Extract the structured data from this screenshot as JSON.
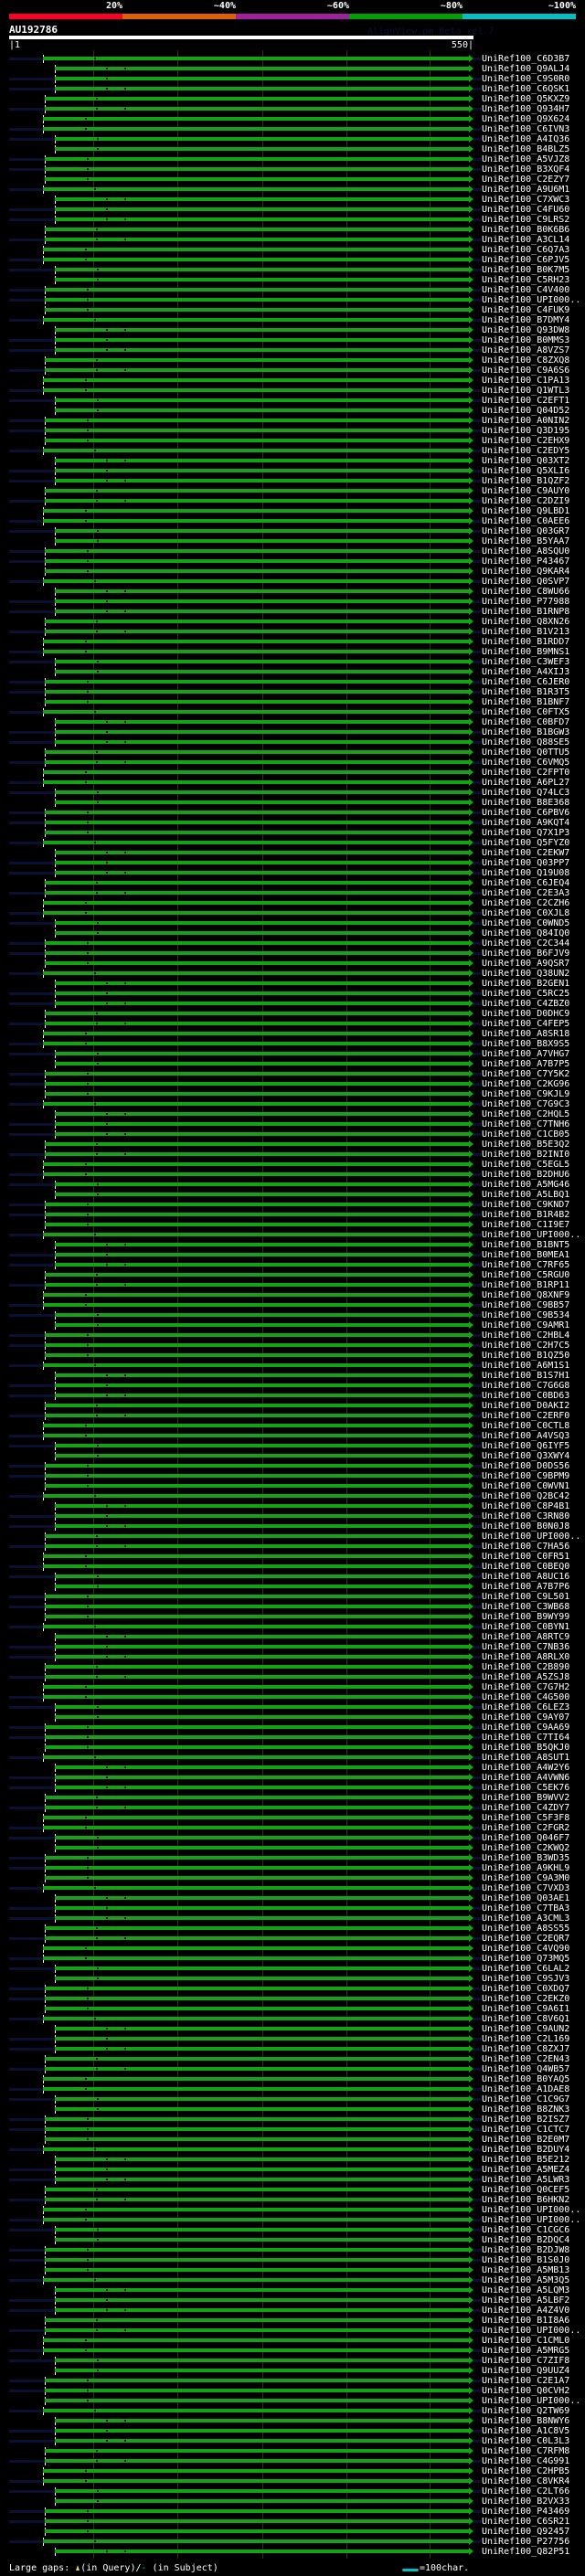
{
  "legend": {
    "scale": [
      {
        "label": "20%",
        "color": "#ff0022"
      },
      {
        "label": "~40%",
        "color": "#e06000"
      },
      {
        "label": "~60%",
        "color": "#a020a0"
      },
      {
        "label": "~80%",
        "color": "#00a000"
      },
      {
        "label": "~100%",
        "color": "#00c0c8"
      }
    ]
  },
  "header": {
    "query_id": "AU192786",
    "credit": "AlignView.pm Beta rel.7",
    "ruler_start": "|1",
    "ruler_end": "550|"
  },
  "colors": {
    "hit_bar": "#13a313",
    "unaligned": "#0b1033",
    "background": "#000000"
  },
  "rows": [
    "UniRef100_C6D3B7",
    "UniRef100_Q9ALJ4",
    "UniRef100_C9S0R0",
    "UniRef100_C6QSK1",
    "UniRef100_Q5KXZ9",
    "UniRef100_Q934H7",
    "UniRef100_Q9X624",
    "UniRef100_C6IVN3",
    "UniRef100_A4IQ36",
    "UniRef100_B4BLZ5",
    "UniRef100_A5VJZ8",
    "UniRef100_B3XQF4",
    "UniRef100_C2EZY7",
    "UniRef100_A9U6M1",
    "UniRef100_C7XWC3",
    "UniRef100_C4FU60",
    "UniRef100_C9LRS2",
    "UniRef100_B0K6B6",
    "UniRef100_A3CL14",
    "UniRef100_C6Q7A3",
    "UniRef100_C6PJV5",
    "UniRef100_B0K7M5",
    "UniRef100_C5RH23",
    "UniRef100_C4V400",
    "UniRef100_UPI000..",
    "UniRef100_C4FUK9",
    "UniRef100_B7DMY4",
    "UniRef100_Q93DW8",
    "UniRef100_B0MMS3",
    "UniRef100_A8VZS7",
    "UniRef100_C8ZXQ8",
    "UniRef100_C9A6S6",
    "UniRef100_C1PA13",
    "UniRef100_Q1WTL3",
    "UniRef100_C2EFT1",
    "UniRef100_Q04D52",
    "UniRef100_A0NIN2",
    "UniRef100_Q3D195",
    "UniRef100_C2EHX9",
    "UniRef100_C2EDY5",
    "UniRef100_Q03XT2",
    "UniRef100_Q5XLI6",
    "UniRef100_B1QZF2",
    "UniRef100_C9AUY0",
    "UniRef100_C2DZI9",
    "UniRef100_Q9LBD1",
    "UniRef100_C0AEE6",
    "UniRef100_Q03GR7",
    "UniRef100_B5YAA7",
    "UniRef100_A8SQU0",
    "UniRef100_P43467",
    "UniRef100_Q9KAR4",
    "UniRef100_Q0SVP7",
    "UniRef100_C8WU66",
    "UniRef100_P77988",
    "UniRef100_B1RNP8",
    "UniRef100_Q8XN26",
    "UniRef100_B1V213",
    "UniRef100_B1RDD7",
    "UniRef100_B9MNS1",
    "UniRef100_C3WEF3",
    "UniRef100_A4XIJ3",
    "UniRef100_C6JER0",
    "UniRef100_B1R3T5",
    "UniRef100_B1BNF7",
    "UniRef100_C0FTX5",
    "UniRef100_C0BFD7",
    "UniRef100_B1BGW3",
    "UniRef100_Q88SE5",
    "UniRef100_Q0TTU5",
    "UniRef100_C6VMQ5",
    "UniRef100_C2FPT0",
    "UniRef100_A6PL27",
    "UniRef100_Q74LC3",
    "UniRef100_B8E368",
    "UniRef100_C6PBV6",
    "UniRef100_A9KQT4",
    "UniRef100_Q7X1P3",
    "UniRef100_Q5FYZ0",
    "UniRef100_C2EKW7",
    "UniRef100_Q03PP7",
    "UniRef100_Q19U08",
    "UniRef100_C6JEQ4",
    "UniRef100_C2E3A3",
    "UniRef100_C2CZH6",
    "UniRef100_C0XJL8",
    "UniRef100_C0WND5",
    "UniRef100_Q84IQ0",
    "UniRef100_C2C344",
    "UniRef100_B6FJV9",
    "UniRef100_A9QSR7",
    "UniRef100_Q38UN2",
    "UniRef100_B2GEN1",
    "UniRef100_C5RC25",
    "UniRef100_C4ZBZ0",
    "UniRef100_D0DHC9",
    "UniRef100_C4FEP5",
    "UniRef100_A8SR18",
    "UniRef100_B8X9S5",
    "UniRef100_A7VHG7",
    "UniRef100_A7B7P5",
    "UniRef100_C7Y5K2",
    "UniRef100_C2KG96",
    "UniRef100_C9KJL9",
    "UniRef100_C7G9C3",
    "UniRef100_C2HQL5",
    "UniRef100_C7TNH6",
    "UniRef100_C1CB05",
    "UniRef100_B5E3Q2",
    "UniRef100_B2INI0",
    "UniRef100_C5EGL5",
    "UniRef100_B2DHU6",
    "UniRef100_A5MG46",
    "UniRef100_A5LBQ1",
    "UniRef100_C9KND7",
    "UniRef100_B1R4B2",
    "UniRef100_C1I9E7",
    "UniRef100_UPI000..",
    "UniRef100_B1BNT5",
    "UniRef100_B0MEA1",
    "UniRef100_C7RF65",
    "UniRef100_C5RGU0",
    "UniRef100_B1RP11",
    "UniRef100_Q8XNF9",
    "UniRef100_C9BB57",
    "UniRef100_C9B534",
    "UniRef100_C9AMR1",
    "UniRef100_C2HBL4",
    "UniRef100_C2H7C5",
    "UniRef100_B1QZ50",
    "UniRef100_A6M1S1",
    "UniRef100_B1S7H1",
    "UniRef100_C7G6G8",
    "UniRef100_C0BD63",
    "UniRef100_D0AKI2",
    "UniRef100_C2ERF0",
    "UniRef100_C0CTL8",
    "UniRef100_A4VSQ3",
    "UniRef100_Q6IYF5",
    "UniRef100_Q3XWY4",
    "UniRef100_D0DS56",
    "UniRef100_C9BPM9",
    "UniRef100_C0WVN1",
    "UniRef100_Q2BC42",
    "UniRef100_C8P4B1",
    "UniRef100_C3RN80",
    "UniRef100_B0N0J8",
    "UniRef100_UPI000..",
    "UniRef100_C7HA56",
    "UniRef100_C0FR51",
    "UniRef100_C0BEQ0",
    "UniRef100_A8UC16",
    "UniRef100_A7B7P6",
    "UniRef100_C9L501",
    "UniRef100_C3WB68",
    "UniRef100_B9WY99",
    "UniRef100_C0BYN1",
    "UniRef100_A8RTC9",
    "UniRef100_C7NB36",
    "UniRef100_A8RLX0",
    "UniRef100_C2B890",
    "UniRef100_A5ZSJ8",
    "UniRef100_C7G7H2",
    "UniRef100_C4G500",
    "UniRef100_C6LEZ3",
    "UniRef100_C9AY07",
    "UniRef100_C9AA69",
    "UniRef100_C7TI64",
    "UniRef100_B5QKJ0",
    "UniRef100_A8SUT1",
    "UniRef100_A4W2Y6",
    "UniRef100_A4VWN6",
    "UniRef100_C5EK76",
    "UniRef100_B9WVV2",
    "UniRef100_C4ZDY7",
    "UniRef100_C5F3F8",
    "UniRef100_C2FGR2",
    "UniRef100_Q046F7",
    "UniRef100_C2KWQ2",
    "UniRef100_B3WD35",
    "UniRef100_A9KHL9",
    "UniRef100_C9A3M0",
    "UniRef100_C7VXD3",
    "UniRef100_Q03AE1",
    "UniRef100_C7TBA3",
    "UniRef100_A3CML3",
    "UniRef100_A8SS55",
    "UniRef100_C2EQR7",
    "UniRef100_C4VQ90",
    "UniRef100_Q73MQ5",
    "UniRef100_C6LAL2",
    "UniRef100_C9SJV3",
    "UniRef100_C0XDQ7",
    "UniRef100_C2EKZ0",
    "UniRef100_C9A6I1",
    "UniRef100_C8V6Q1",
    "UniRef100_C9AUN2",
    "UniRef100_C2L169",
    "UniRef100_C8ZXJ7",
    "UniRef100_C2EN43",
    "UniRef100_Q4WB57",
    "UniRef100_B0YAQ5",
    "UniRef100_A1DAE8",
    "UniRef100_C1C9G7",
    "UniRef100_B8ZNK3",
    "UniRef100_B2ISZ7",
    "UniRef100_C1CTC7",
    "UniRef100_B2E0M7",
    "UniRef100_B2DUY4",
    "UniRef100_B5E212",
    "UniRef100_A5MEZ4",
    "UniRef100_A5LWR3",
    "UniRef100_Q0CEF5",
    "UniRef100_B6HKN2",
    "UniRef100_UPI000..",
    "UniRef100_UPI000..",
    "UniRef100_C1CGC6",
    "UniRef100_B2DQC4",
    "UniRef100_B2DJW8",
    "UniRef100_B1S0J0",
    "UniRef100_A5MB13",
    "UniRef100_A5M3Q5",
    "UniRef100_A5LQM3",
    "UniRef100_A5LBF2",
    "UniRef100_A4Z4V0",
    "UniRef100_B1I8A6",
    "UniRef100_UPI000..",
    "UniRef100_C1CML0",
    "UniRef100_A5MRG5",
    "UniRef100_C7ZIF8",
    "UniRef100_Q9UUZ4",
    "UniRef100_C2E1A7",
    "UniRef100_Q0CVH2",
    "UniRef100_UPI000..",
    "UniRef100_Q2TW69",
    "UniRef100_B8NWY6",
    "UniRef100_A1C8V5",
    "UniRef100_C0L3L3",
    "UniRef100_C7RFM8",
    "UniRef100_C4G991",
    "UniRef100_C2HPB5",
    "UniRef100_C8VKR4",
    "UniRef100_C2LT66",
    "UniRef100_B2VX33",
    "UniRef100_P43469",
    "UniRef100_C6SR21",
    "UniRef100_Q92457",
    "UniRef100_P27756",
    "UniRef100_Q82P51"
  ],
  "footer": {
    "large_gaps_label": "Large gaps:",
    "in_query": "(in Query)/",
    "subject_gap_glyph": "-",
    "in_subject": " (in Subject)",
    "scale_label": "=100char."
  }
}
